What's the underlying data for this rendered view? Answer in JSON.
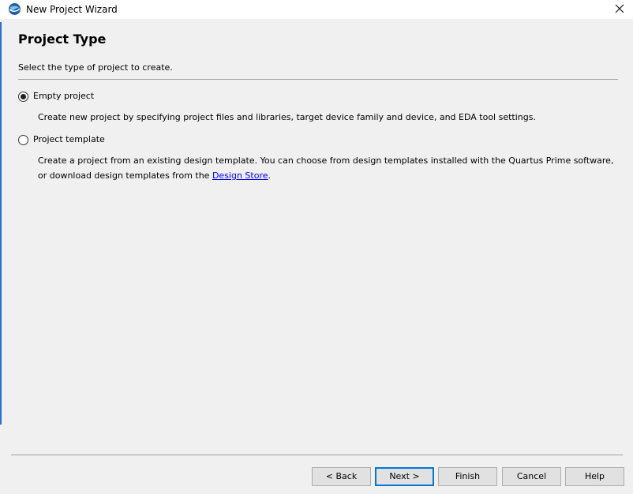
{
  "window": {
    "title": "New Project Wizard",
    "close_glyph": "✕",
    "app_icon": "quartus-globe-icon"
  },
  "header": {
    "title": "Project Type",
    "subtitle": "Select the type of project to create."
  },
  "options": [
    {
      "label": "Empty project",
      "selected": true,
      "description": "Create new project by specifying project files and libraries, target device family and device, and EDA tool settings."
    },
    {
      "label": "Project template",
      "selected": false,
      "description_before_link": "Create a project from an existing design template. You can choose from design templates installed with the Quartus Prime software, or download design templates from the ",
      "link_text": "Design Store",
      "description_after_link": "."
    }
  ],
  "buttons": {
    "back": "< Back",
    "next": "Next >",
    "finish": "Finish",
    "cancel": "Cancel",
    "help": "Help"
  },
  "colors": {
    "accent": "#0078d7",
    "link": "#0000ee",
    "background": "#f0f0f0"
  }
}
